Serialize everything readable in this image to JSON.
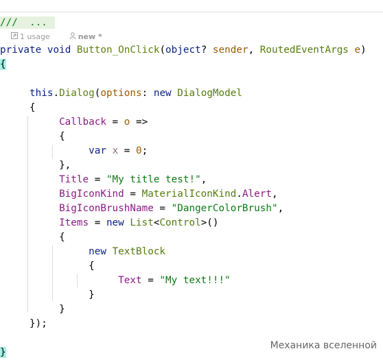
{
  "fold_text": "///  ...",
  "hints": {
    "usages": "1 usage",
    "author": "new *"
  },
  "code": {
    "sig_private": "private",
    "sig_void": "void",
    "sig_method": "Button_OnClick",
    "sig_open": "(",
    "sig_object": "object",
    "sig_q": "? ",
    "sig_sender": "sender",
    "sig_comma": ", ",
    "sig_rea": "RoutedEventArgs",
    "sig_e": "e",
    "sig_close": ")",
    "brace_open": "{",
    "this": "this",
    "dot": ".",
    "dialog": "Dialog",
    "paren_open": "(",
    "options": "options",
    "colon": ": ",
    "new": "new",
    "dialog_model": "DialogModel",
    "callback": "Callback",
    "eq": " = ",
    "o": "o",
    "arrow": " =>",
    "var": "var",
    "x": "x",
    "zero": "0",
    "semi": ";",
    "close_comma": "},",
    "title_prop": "Title",
    "title_val": "\"My title test!\"",
    "comma": ",",
    "bigicon_prop": "BigIconKind",
    "mik": "MaterialIconKind",
    "alert": "Alert",
    "brush_prop": "BigIconBrushName",
    "brush_val": "\"DangerColorBrush\"",
    "items_prop": "Items",
    "list": "List",
    "lt": "<",
    "control": "Control",
    "gt_parens": ">()",
    "textblock": "TextBlock",
    "text_prop": "Text",
    "text_val": "\"My text!!!\"",
    "close": "}",
    "close_paren_semi": "});",
    "brace_close": "}"
  },
  "watermark": "Механика вселенной"
}
